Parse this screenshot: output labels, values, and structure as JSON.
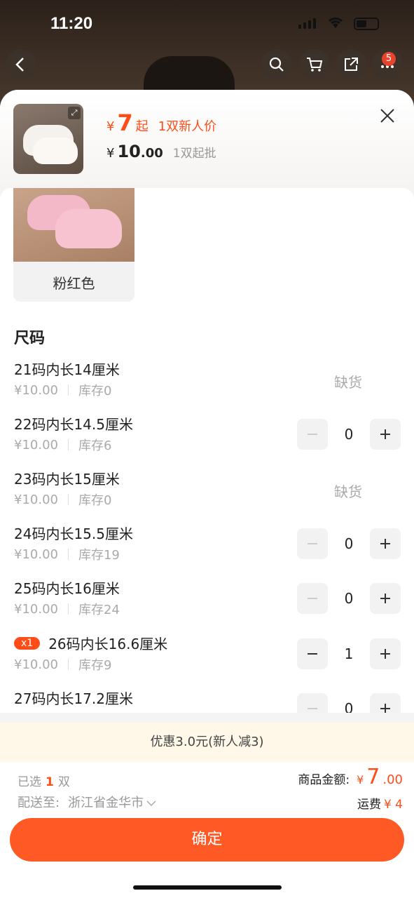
{
  "status_bar": {
    "time": "11:20"
  },
  "top_bar": {
    "cart_badge": "5"
  },
  "header": {
    "price_symbol": "¥",
    "new_price": "7",
    "new_price_suffix": "起",
    "new_price_tag": "1双新人价",
    "price_symbol2": "¥",
    "price_int": "10",
    "price_dec": ".00",
    "min_order": "1双起批"
  },
  "color_option": {
    "label": "粉红色"
  },
  "size_section": {
    "title": "尺码",
    "rows": [
      {
        "name": "21码内长14厘米",
        "price": "¥10.00",
        "stock": "库存0",
        "out_of_stock": "缺货"
      },
      {
        "name": "22码内长14.5厘米",
        "price": "¥10.00",
        "stock": "库存6",
        "qty": "0"
      },
      {
        "name": "23码内长15厘米",
        "price": "¥10.00",
        "stock": "库存0",
        "out_of_stock": "缺货"
      },
      {
        "name": "24码内长15.5厘米",
        "price": "¥10.00",
        "stock": "库存19",
        "qty": "0"
      },
      {
        "name": "25码内长16厘米",
        "price": "¥10.00",
        "stock": "库存24",
        "qty": "0"
      },
      {
        "name": "26码内长16.6厘米",
        "badge": "x1",
        "price": "¥10.00",
        "stock": "库存9",
        "qty": "1"
      },
      {
        "name": "27码内长17.2厘米",
        "qty": "0"
      }
    ]
  },
  "promo": {
    "text": "优惠3.0元(新人减3)"
  },
  "footer": {
    "selected_prefix": "已选",
    "selected_count": "1",
    "selected_unit": "双",
    "ship_label": "配送至:",
    "ship_location": "浙江省金华市",
    "amount_label": "商品金额:",
    "amount_symbol": "¥",
    "amount_int": "7",
    "amount_dec": ".00",
    "fee_label": "运费",
    "fee_value": "¥ 4",
    "confirm_label": "确定"
  },
  "colors": {
    "accent": "#ff4d1a",
    "button": "#ff5a26"
  }
}
